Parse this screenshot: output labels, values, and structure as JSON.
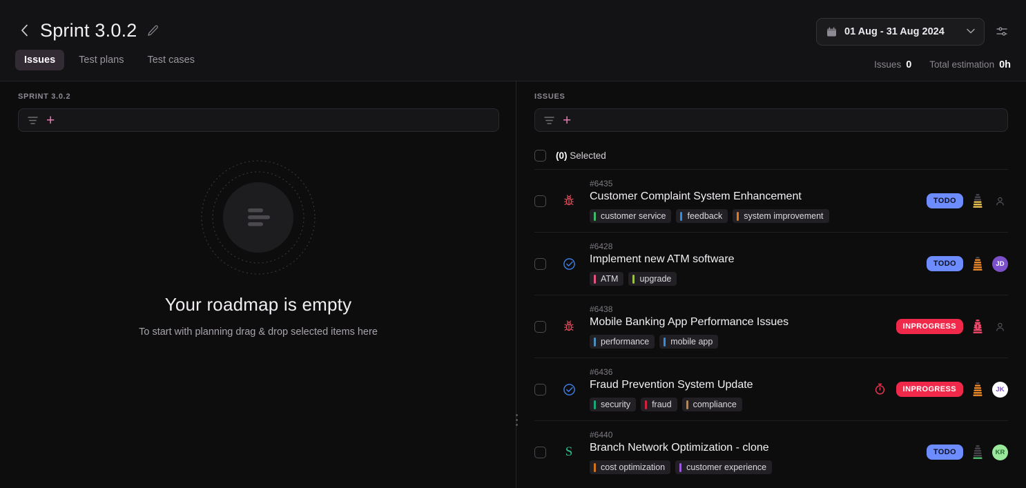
{
  "header": {
    "back_icon": "chevron-left-icon",
    "title": "Sprint 3.0.2",
    "edit_icon": "pencil-icon",
    "tabs": [
      {
        "label": "Issues",
        "active": true
      },
      {
        "label": "Test plans",
        "active": false
      },
      {
        "label": "Test cases",
        "active": false
      }
    ],
    "date_range": {
      "calendar_icon": "calendar-icon",
      "value": "01 Aug - 31 Aug 2024",
      "chevron_icon": "chevron-down-icon"
    },
    "settings_icon": "sliders-icon",
    "stats": {
      "issues_label": "Issues",
      "issues_value": "0",
      "estimation_label": "Total estimation",
      "estimation_value": "0h"
    }
  },
  "left_panel": {
    "label": "SPRINT 3.0.2",
    "filter_icon": "filter-icon",
    "add_label": "+",
    "empty_state": {
      "title": "Your roadmap is empty",
      "subtitle": "To start with planning drag & drop selected items here"
    }
  },
  "right_panel": {
    "label": "ISSUES",
    "filter_icon": "filter-icon",
    "add_label": "+",
    "selection": {
      "count": "(0)",
      "label": "Selected"
    },
    "issues": [
      {
        "key": "#6435",
        "title": "Customer Complaint System Enhancement",
        "type": "bug",
        "type_color": "#e14b5a",
        "tags": [
          {
            "label": "customer service",
            "color": "#3fb96a"
          },
          {
            "label": "feedback",
            "color": "#2f8fe0"
          },
          {
            "label": "system improvement",
            "color": "#e07a1f"
          }
        ],
        "status": "TODO",
        "status_bg": "#6c8cff",
        "status_fg": "#10101c",
        "priority": "medium",
        "priority_color": "#e8c252",
        "priority_filled": 3,
        "has_timer": false,
        "assignee": {
          "initials": "",
          "bg": "",
          "fg": ""
        }
      },
      {
        "key": "#6428",
        "title": "Implement new ATM software",
        "type": "task",
        "type_color": "#3b7de0",
        "tags": [
          {
            "label": "ATM",
            "color": "#e6537f"
          },
          {
            "label": "upgrade",
            "color": "#9cc24a"
          }
        ],
        "status": "TODO",
        "status_bg": "#6c8cff",
        "status_fg": "#10101c",
        "priority": "high",
        "priority_color": "#ef8a2b",
        "priority_filled": 5,
        "has_timer": false,
        "assignee": {
          "initials": "JD",
          "bg": "#7b50c9",
          "fg": "#ffffff"
        }
      },
      {
        "key": "#6438",
        "title": "Mobile Banking App Performance Issues",
        "type": "bug",
        "type_color": "#e14b5a",
        "tags": [
          {
            "label": "performance",
            "color": "#4a8fbf"
          },
          {
            "label": "mobile app",
            "color": "#2f8fe0"
          }
        ],
        "status": "INPROGRESS",
        "status_bg": "#f0294a",
        "status_fg": "#ffffff",
        "priority": "critical",
        "priority_color": "#f0486a",
        "priority_filled": 6,
        "has_timer": false,
        "assignee": {
          "initials": "",
          "bg": "",
          "fg": ""
        }
      },
      {
        "key": "#6436",
        "title": "Fraud Prevention System Update",
        "type": "task",
        "type_color": "#3b7de0",
        "tags": [
          {
            "label": "security",
            "color": "#19a877"
          },
          {
            "label": "fraud",
            "color": "#cf2340"
          },
          {
            "label": "compliance",
            "color": "#b08a5e"
          }
        ],
        "status": "INPROGRESS",
        "status_bg": "#f0294a",
        "status_fg": "#ffffff",
        "priority": "high",
        "priority_color": "#ef8a2b",
        "priority_filled": 5,
        "has_timer": true,
        "timer_color": "#e8334f",
        "assignee": {
          "initials": "JK",
          "bg": "#ffffff",
          "fg": "#7b50c9"
        }
      },
      {
        "key": "#6440",
        "title": "Branch Network Optimization - clone",
        "type": "story",
        "type_label": "S",
        "type_color": "#2fbf8f",
        "tags": [
          {
            "label": "cost optimization",
            "color": "#d2751a"
          },
          {
            "label": "customer experience",
            "color": "#9b59e0"
          }
        ],
        "status": "TODO",
        "status_bg": "#6c8cff",
        "status_fg": "#10101c",
        "priority": "low",
        "priority_color": "#4cc36a",
        "priority_filled": 1,
        "has_timer": false,
        "assignee": {
          "initials": "KR",
          "bg": "#9ae89a",
          "fg": "#2b6b38"
        }
      }
    ]
  },
  "divider": {
    "handle_icon": "drag-handle-icon"
  }
}
